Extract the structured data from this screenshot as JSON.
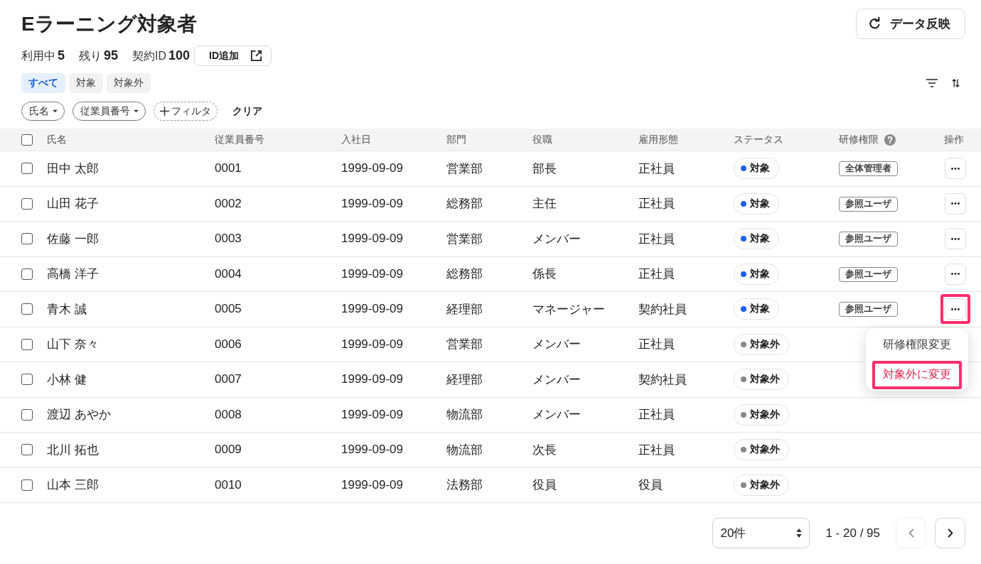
{
  "page": {
    "title": "Eラーニング対象者",
    "refresh_button": "データ反映"
  },
  "stats": [
    {
      "label": "利用中",
      "value": "5"
    },
    {
      "label": "残り",
      "value": "95"
    },
    {
      "label": "契約ID",
      "value": "100"
    }
  ],
  "add_id_button": "ID追加",
  "segments": [
    {
      "label": "すべて",
      "selected": true
    },
    {
      "label": "対象",
      "selected": false
    },
    {
      "label": "対象外",
      "selected": false
    }
  ],
  "filters": [
    {
      "label": "氏名",
      "kind": "dropdown"
    },
    {
      "label": "従業員番号",
      "kind": "dropdown"
    },
    {
      "label": "フィルタ",
      "kind": "add"
    }
  ],
  "clear_button": "クリア",
  "table": {
    "select_all_checked": false,
    "columns": [
      {
        "label": "氏名",
        "help": false
      },
      {
        "label": "従業員番号",
        "help": false
      },
      {
        "label": "入社日",
        "help": false
      },
      {
        "label": "部門",
        "help": false
      },
      {
        "label": "役職",
        "help": false
      },
      {
        "label": "雇用形態",
        "help": false
      },
      {
        "label": "ステータス",
        "help": false
      },
      {
        "label": "研修権限",
        "help": true
      },
      {
        "label": "操作",
        "help": false
      }
    ],
    "rows": [
      {
        "checked": false,
        "name": "田中 太郎",
        "employee_no": "0001",
        "hire_date": "1999-09-09",
        "department": "営業部",
        "position": "部長",
        "employment_type": "正社員",
        "status": {
          "label": "対象",
          "color": "#1d5ff2"
        },
        "permission": "全体管理者",
        "action": {
          "highlighted": false
        }
      },
      {
        "checked": false,
        "name": "山田 花子",
        "employee_no": "0002",
        "hire_date": "1999-09-09",
        "department": "総務部",
        "position": "主任",
        "employment_type": "正社員",
        "status": {
          "label": "対象",
          "color": "#1d5ff2"
        },
        "permission": "参照ユーザ",
        "action": {
          "highlighted": false
        }
      },
      {
        "checked": false,
        "name": "佐藤 一郎",
        "employee_no": "0003",
        "hire_date": "1999-09-09",
        "department": "営業部",
        "position": "メンバー",
        "employment_type": "正社員",
        "status": {
          "label": "対象",
          "color": "#1d5ff2"
        },
        "permission": "参照ユーザ",
        "action": {
          "highlighted": false
        }
      },
      {
        "checked": false,
        "name": "高橋 洋子",
        "employee_no": "0004",
        "hire_date": "1999-09-09",
        "department": "総務部",
        "position": "係長",
        "employment_type": "正社員",
        "status": {
          "label": "対象",
          "color": "#1d5ff2"
        },
        "permission": "参照ユーザ",
        "action": {
          "highlighted": false
        }
      },
      {
        "checked": false,
        "name": "青木 誠",
        "employee_no": "0005",
        "hire_date": "1999-09-09",
        "department": "経理部",
        "position": "マネージャー",
        "employment_type": "契約社員",
        "status": {
          "label": "対象",
          "color": "#1d5ff2"
        },
        "permission": "参照ユーザ",
        "action": {
          "highlighted": true,
          "menu": {
            "items": [
              {
                "label": "研修権限変更",
                "kind": "normal",
                "highlighted": false
              },
              {
                "label": "対象外に変更",
                "kind": "danger",
                "highlighted": true
              }
            ]
          }
        }
      },
      {
        "checked": false,
        "name": "山下 奈々",
        "employee_no": "0006",
        "hire_date": "1999-09-09",
        "department": "営業部",
        "position": "メンバー",
        "employment_type": "正社員",
        "status": {
          "label": "対象外",
          "color": "#888888"
        }
      },
      {
        "checked": false,
        "name": "小林 健",
        "employee_no": "0007",
        "hire_date": "1999-09-09",
        "department": "経理部",
        "position": "メンバー",
        "employment_type": "契約社員",
        "status": {
          "label": "対象外",
          "color": "#888888"
        }
      },
      {
        "checked": false,
        "name": "渡辺 あやか",
        "employee_no": "0008",
        "hire_date": "1999-09-09",
        "department": "物流部",
        "position": "メンバー",
        "employment_type": "正社員",
        "status": {
          "label": "対象外",
          "color": "#888888"
        }
      },
      {
        "checked": false,
        "name": "北川 拓也",
        "employee_no": "0009",
        "hire_date": "1999-09-09",
        "department": "物流部",
        "position": "次長",
        "employment_type": "正社員",
        "status": {
          "label": "対象外",
          "color": "#888888"
        }
      },
      {
        "checked": false,
        "name": "山本 三郎",
        "employee_no": "0010",
        "hire_date": "1999-09-09",
        "department": "法務部",
        "position": "役員",
        "employment_type": "役員",
        "status": {
          "label": "対象外",
          "color": "#888888"
        }
      }
    ]
  },
  "pagination": {
    "page_size": "20件",
    "range": "1 - 20 / 95",
    "prev_disabled": true,
    "next_disabled": false
  }
}
